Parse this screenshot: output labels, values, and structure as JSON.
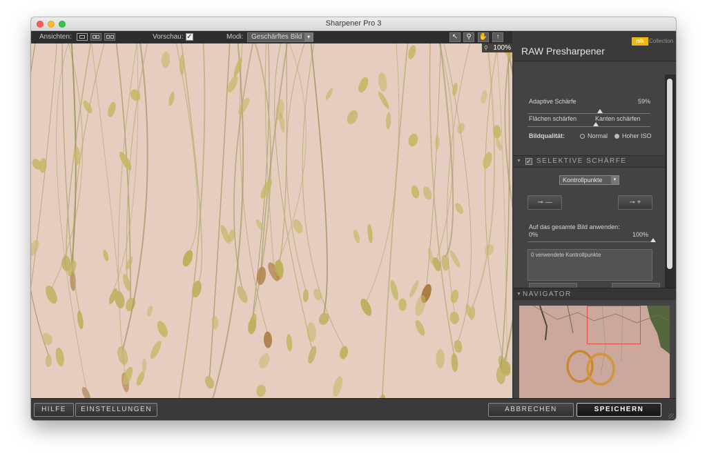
{
  "window": {
    "title": "Sharpener Pro 3"
  },
  "toolbar": {
    "views_label": "Ansichten:",
    "preview_label": "Vorschau:",
    "preview_checked": "✓",
    "modes_label": "Modi:",
    "mode_value": "Geschärftes Bild",
    "tool_icons": [
      "arrow-icon",
      "zoom-icon",
      "hand-icon",
      "pin-icon"
    ]
  },
  "preview": {
    "zoom": "100%"
  },
  "panel": {
    "brand": "nik",
    "brand_suffix": "Collection",
    "title": "RAW Presharpener",
    "adaptive_label": "Adaptive Schärfe",
    "adaptive_value": "59%",
    "adaptive_level": 0.59,
    "surface_label": "Flächen schärfen",
    "edge_label": "Kanten schärfen",
    "quality_label": "Bildqualität:",
    "quality_options": [
      "Normal",
      "Hoher ISO"
    ],
    "quality_selected": "Hoher ISO"
  },
  "selective": {
    "header": "SELEKTIVE SCHÄRFE",
    "checked": "✓",
    "select_value": "Kontrollpunkte",
    "apply_label": "Auf das gesamte Bild anwenden:",
    "apply_min": "0%",
    "apply_max": "100%",
    "apply_level": 1.0,
    "points_text": "0 verwendete Kontrollpunkte"
  },
  "navigator": {
    "header": "NAVIGATOR"
  },
  "bottom": {
    "help": "HILFE",
    "settings": "EINSTELLUNGEN",
    "cancel": "ABBRECHEN",
    "save": "SPEICHERN"
  },
  "colors": {
    "background_dark": "#3a3a3a",
    "panel": "#434343",
    "brand": "#f1b50f",
    "navigator_frame": "#e24b45",
    "preview_bg": "#e6cbbd"
  }
}
